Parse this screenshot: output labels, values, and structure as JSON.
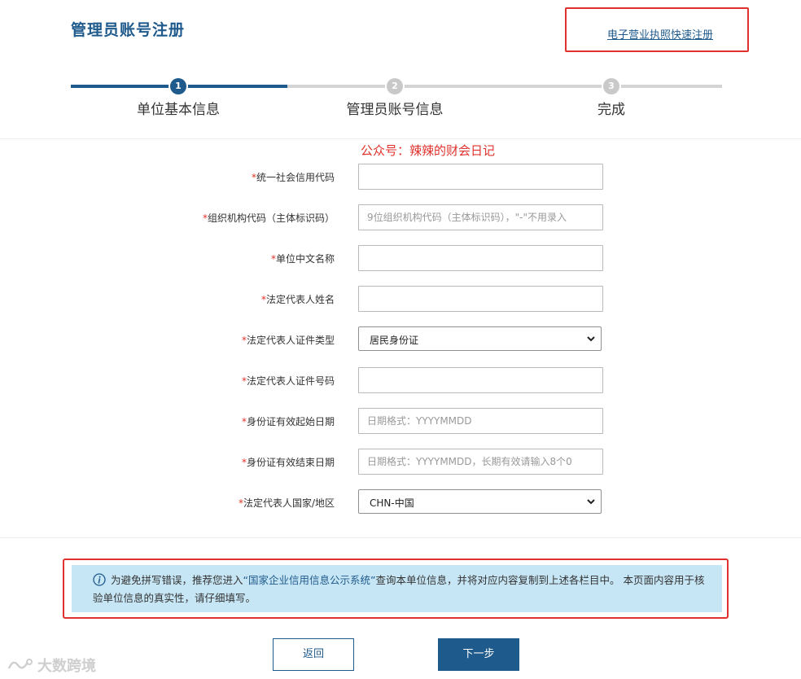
{
  "header": {
    "title": "管理员账号注册",
    "quick_register_link": "电子营业执照快速注册"
  },
  "steps": [
    {
      "number": "1",
      "label": "单位基本信息",
      "state": "active"
    },
    {
      "number": "2",
      "label": "管理员账号信息",
      "state": "inactive"
    },
    {
      "number": "3",
      "label": "完成",
      "state": "inactive"
    }
  ],
  "overlay_text": "公众号：辣辣的财会日记",
  "form": {
    "required_mark": "*",
    "fields": [
      {
        "label": "统一社会信用代码",
        "value": "",
        "placeholder": ""
      },
      {
        "label": "组织机构代码（主体标识码）",
        "value": "",
        "placeholder": "9位组织机构代码（主体标识码），\"-\"不用录入"
      },
      {
        "label": "单位中文名称",
        "value": "",
        "placeholder": ""
      },
      {
        "label": "法定代表人姓名",
        "value": "",
        "placeholder": ""
      },
      {
        "label": "法定代表人证件类型",
        "selected": "居民身份证"
      },
      {
        "label": "法定代表人证件号码",
        "value": "",
        "placeholder": ""
      },
      {
        "label": "身份证有效起始日期",
        "value": "",
        "placeholder": "日期格式：YYYYMMDD"
      },
      {
        "label": "身份证有效结束日期",
        "value": "",
        "placeholder": "日期格式：YYYYMMDD，长期有效请输入8个0"
      },
      {
        "label": "法定代表人国家/地区",
        "selected": "CHN-中国"
      }
    ]
  },
  "notice": {
    "prefix": "为避免拼写错误，推荐您进入",
    "link": "“国家企业信用信息公示系统”",
    "suffix": "查询本单位信息，并将对应内容复制到上述各栏目中。 本页面内容用于核验单位信息的真实性，请仔细填写。"
  },
  "buttons": {
    "back": "返回",
    "next": "下一步"
  },
  "watermark": "大数跨境",
  "icons": [
    "info-icon",
    "chevron-down-icon",
    "watermark-logo-icon"
  ],
  "colors": {
    "primary": "#1f5a8c",
    "highlight_red": "#e0322d",
    "notice_bg": "#c7e6f5",
    "step_inactive": "#c9c9c9"
  }
}
